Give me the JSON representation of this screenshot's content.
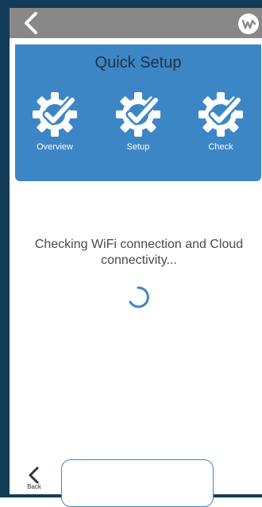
{
  "header": {
    "back_icon": "chevron-left-icon",
    "logo_icon": "w-logo-icon"
  },
  "panel": {
    "title": "Quick Setup",
    "steps": [
      {
        "label": "Overview",
        "icon": "gear-check-icon"
      },
      {
        "label": "Setup",
        "icon": "gear-check-icon"
      },
      {
        "label": "Check",
        "icon": "gear-check-icon"
      }
    ]
  },
  "status": {
    "message": "Checking WiFi connection and Cloud connectivity..."
  },
  "footer": {
    "back_label": "Back",
    "button_label": ""
  },
  "colors": {
    "frame": "#123c57",
    "header": "#888888",
    "panel": "#3d86c6",
    "accent": "#3d86c6"
  }
}
